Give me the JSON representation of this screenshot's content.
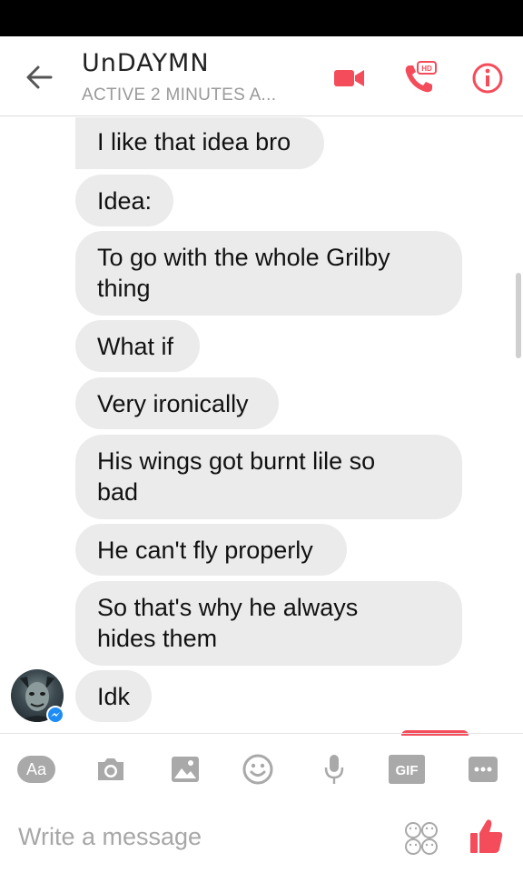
{
  "header": {
    "contact_name": "UnDAYMN",
    "status": "ACTIVE 2 MINUTES A...",
    "hd_badge": "HD"
  },
  "messages": [
    "I like that idea bro",
    "Idea:",
    "To go with the whole Grilby\nthing",
    "What if",
    "Very ironically",
    "His wings got burnt lile so\nbad",
    "He can't fly properly",
    "So that's why he always\nhides them",
    "Idk"
  ],
  "composer": {
    "text_button": "Aa",
    "gif_button": "GIF",
    "placeholder": "Write a message"
  },
  "colors": {
    "accent": "#f44c5b",
    "bubble": "#ebebeb",
    "messenger_badge": "#1d8cf5",
    "toolbar_icon": "#a9a9a9"
  }
}
